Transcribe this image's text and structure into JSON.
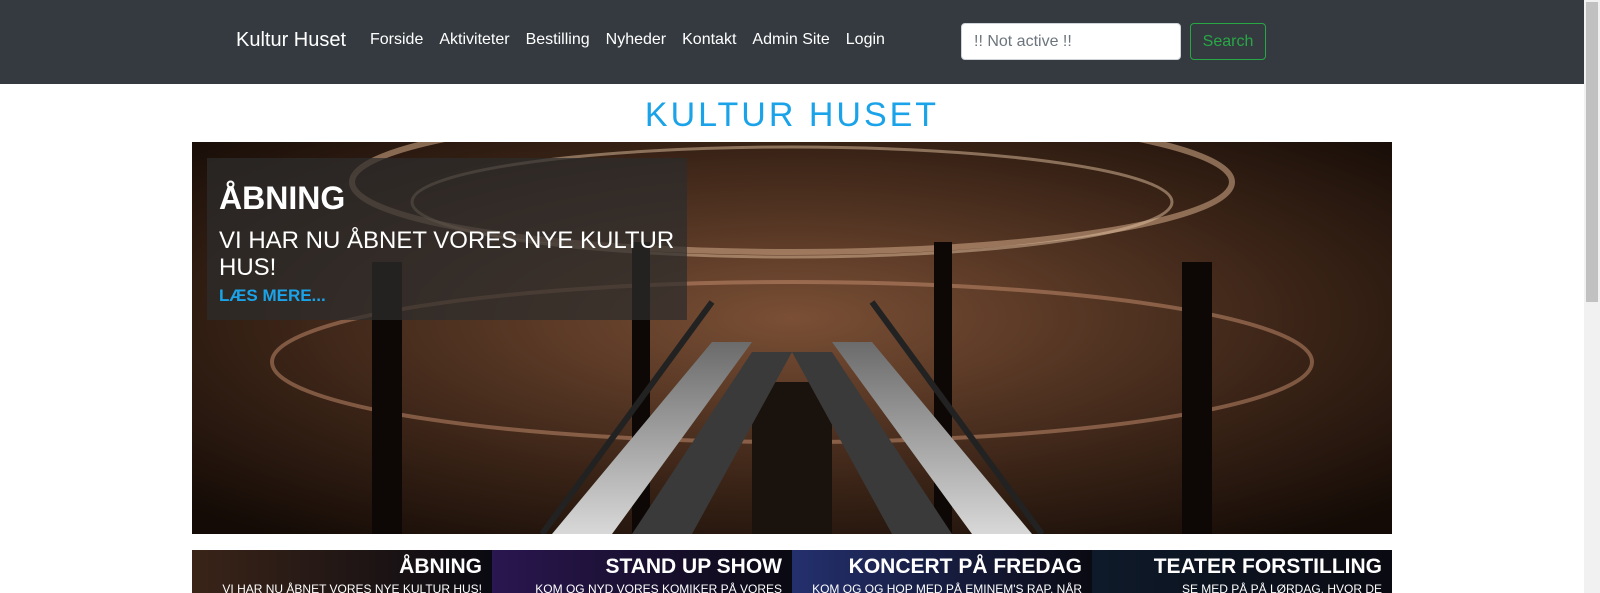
{
  "navbar": {
    "brand": "Kultur Huset",
    "links": [
      "Forside",
      "Aktiviteter",
      "Bestilling",
      "Nyheder",
      "Kontakt",
      "Admin Site",
      "Login"
    ],
    "search_placeholder": "!! Not active !!",
    "search_button": "Search"
  },
  "page": {
    "title": "KULTUR HUSET"
  },
  "hero": {
    "title": "ÅBNING",
    "subtitle": "VI HAR NU ÅBNET VORES NYE KULTUR HUS!",
    "link": "LÆS MERE..."
  },
  "cards": [
    {
      "title": "ÅBNING",
      "text": "VI HAR NU ÅBNET VORES NYE KULTUR HUS!",
      "color": "#3a2418"
    },
    {
      "title": "STAND UP SHOW",
      "text": "KOM OG NYD VORES KOMIKER PÅ VORES",
      "color": "#2a1650"
    },
    {
      "title": "KONCERT PÅ FREDAG",
      "text": "KOM OG OG HOP MED PÅ EMINEM'S RAP, NÅR",
      "color": "#24306e"
    },
    {
      "title": "TEATER FORSTILLING",
      "text": "SE MED PÅ PÅ LØRDAG, HVOR DE",
      "color": "#0e1a2a"
    }
  ],
  "colors": {
    "accent": "#1aa3e8",
    "navbar": "#343a40",
    "search": "#28a745"
  }
}
